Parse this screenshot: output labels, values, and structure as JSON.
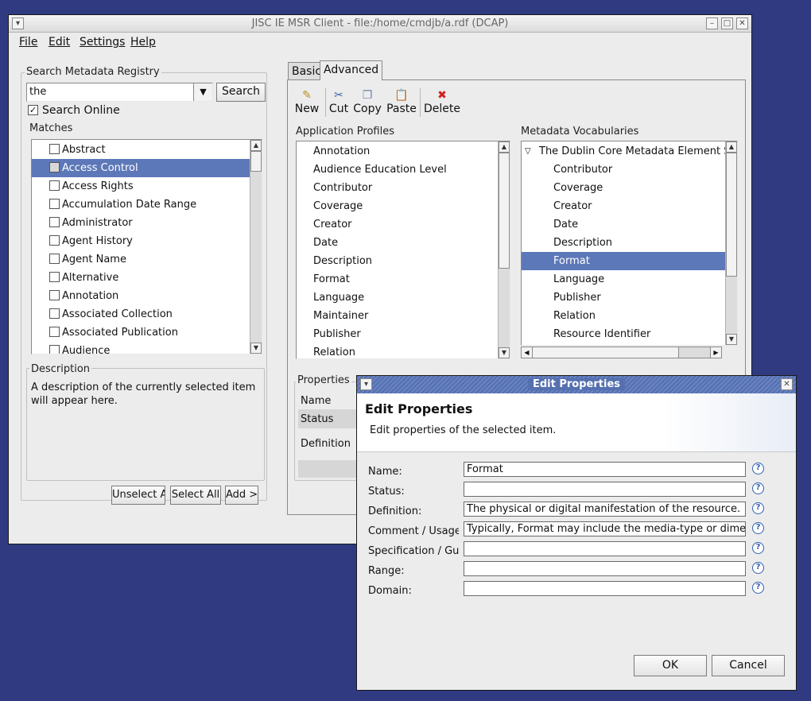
{
  "main_window": {
    "title": "JISC IE MSR Client - file:/home/cmdjb/a.rdf (DCAP)",
    "menu": [
      "File",
      "Edit",
      "Settings",
      "Help"
    ],
    "search": {
      "group_label": "Search Metadata Registry",
      "query": "the",
      "search_button": "Search",
      "search_online_label": "Search Online",
      "search_online_checked": true
    },
    "matches": {
      "label": "Matches",
      "items": [
        "Abstract",
        "Access Control",
        "Access Rights",
        "Accumulation Date Range",
        "Administrator",
        "Agent History",
        "Agent Name",
        "Alternative",
        "Annotation",
        "Associated Collection",
        "Associated Publication",
        "Audience"
      ],
      "selected": "Access Control"
    },
    "description": {
      "label": "Description",
      "text": "A description of the currently selected item will appear here."
    },
    "bottom_buttons": [
      "Unselect A",
      "Select All",
      "Add >"
    ],
    "tabs": [
      "Basic",
      "Advanced"
    ],
    "active_tab": "Advanced",
    "toolbar": [
      {
        "label": "New",
        "icon": "new-icon"
      },
      {
        "label": "Cut",
        "icon": "scissors-icon"
      },
      {
        "label": "Copy",
        "icon": "copy-icon"
      },
      {
        "label": "Paste",
        "icon": "paste-icon"
      },
      {
        "label": "Delete",
        "icon": "delete-icon"
      }
    ],
    "application_profiles": {
      "label": "Application Profiles",
      "items": [
        "Annotation",
        "Audience Education Level",
        "Contributor",
        "Coverage",
        "Creator",
        "Date",
        "Description",
        "Format",
        "Language",
        "Maintainer",
        "Publisher",
        "Relation"
      ]
    },
    "metadata_vocabularies": {
      "label": "Metadata Vocabularies",
      "root": "The Dublin Core Metadata Element Set",
      "items": [
        "Contributor",
        "Coverage",
        "Creator",
        "Date",
        "Description",
        "Format",
        "Language",
        "Publisher",
        "Relation",
        "Resource Identifier"
      ],
      "selected": "Format"
    },
    "properties": {
      "label": "Properties",
      "rows": [
        "Name",
        "Status",
        "Definition"
      ]
    }
  },
  "dialog": {
    "title": "Edit Properties",
    "heading": "Edit Properties",
    "subheading": "Edit properties of the selected item.",
    "fields": [
      {
        "label": "Name:",
        "value": "Format"
      },
      {
        "label": "Status:",
        "value": ""
      },
      {
        "label": "Definition:",
        "value": "The physical or digital manifestation of the  resource."
      },
      {
        "label": "Comment / Usage N",
        "value": "Typically, Format may include the media-type or  dimensions"
      },
      {
        "label": "Specification / Guid",
        "value": ""
      },
      {
        "label": "Range:",
        "value": ""
      },
      {
        "label": "Domain:",
        "value": ""
      }
    ],
    "ok_label": "OK",
    "cancel_label": "Cancel"
  },
  "colors": {
    "desktop": "#2f3a80",
    "selection": "#5d78b8",
    "dialog_titlebar": "#5570b0"
  }
}
